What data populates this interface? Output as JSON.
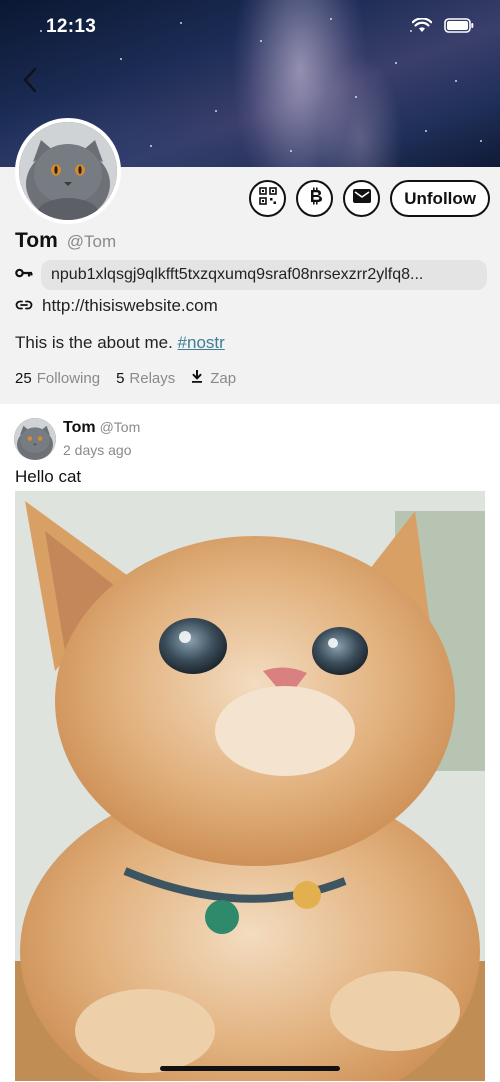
{
  "status_bar": {
    "time": "12:13"
  },
  "profile": {
    "display_name": "Tom",
    "handle": "@Tom",
    "npub": "npub1xlqsgj9qlkfft5txzqxumq9sraf08nrsexzrr2ylfq8...",
    "website": "http://thisiswebsite.com",
    "about_text": "This is the about me. ",
    "about_hashtag": "#nostr",
    "unfollow_label": "Unfollow",
    "stats": {
      "following_count": "25",
      "following_label": "Following",
      "relays_count": "5",
      "relays_label": "Relays",
      "zap_label": "Zap"
    }
  },
  "post": {
    "author_name": "Tom",
    "author_handle": "@Tom",
    "timestamp": "2 days ago",
    "text": "Hello cat"
  },
  "icons": {
    "back": "chevron-left-icon",
    "wifi": "wifi-icon",
    "battery": "battery-icon",
    "qr": "qr-code-icon",
    "bitcoin": "bitcoin-icon",
    "mail": "mail-icon",
    "key": "key-icon",
    "link": "link-icon",
    "zap": "download-icon"
  },
  "colors": {
    "hashtag": "#3e7f93",
    "header_bg": "#f2f2f2",
    "muted_text": "#8a8a8a"
  }
}
